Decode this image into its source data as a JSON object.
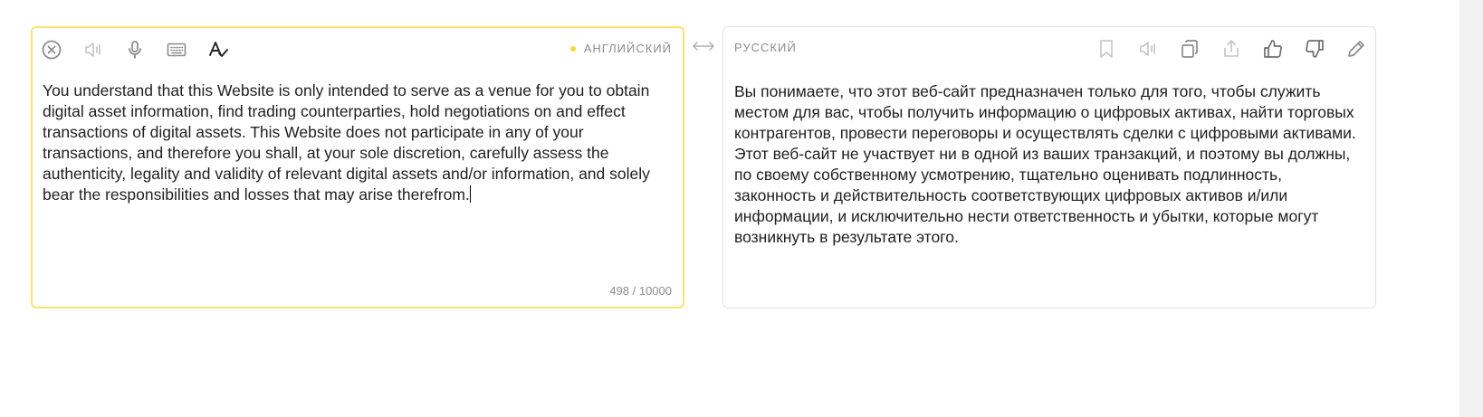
{
  "source": {
    "language": "АНГЛИЙСКИЙ",
    "text": "You understand that this Website is only intended to serve as a venue for you to obtain digital asset information, find trading counterparties, hold negotiations on and effect transactions of digital assets. This Website does not participate in any of your transactions, and therefore you shall, at your sole discretion, carefully assess the authenticity, legality and validity of relevant digital assets and/or information, and solely bear the responsibilities and losses that may arise therefrom.",
    "counter": "498 / 10000",
    "toolbar_icons": [
      "clear-icon",
      "speaker-icon",
      "microphone-icon",
      "keyboard-icon",
      "spellcheck-icon"
    ]
  },
  "target": {
    "language": "РУССКИЙ",
    "text": "Вы понимаете, что этот веб-сайт предназначен только для того, чтобы служить местом для вас, чтобы получить информацию о цифровых активах, найти торговых контрагентов, провести переговоры и осуществлять сделки с цифровыми активами. Этот веб-сайт не участвует ни в одной из ваших транзакций, и поэтому вы должны, по своему собственному усмотрению, тщательно оценивать подлинность, законность и действительность соответствующих цифровых активов и/или информации, и исключительно нести ответственность и убытки, которые могут возникнуть в результате этого.",
    "toolbar_icons": [
      "bookmark-icon",
      "speaker-icon",
      "copy-icon",
      "share-icon",
      "thumbs-up-icon",
      "thumbs-down-icon",
      "edit-icon"
    ]
  },
  "colors": {
    "accent": "#fae36a",
    "dot": "#fdd835",
    "icon": "#a6a6a6",
    "text": "#1f1f1f",
    "muted": "#8c8c8c"
  }
}
